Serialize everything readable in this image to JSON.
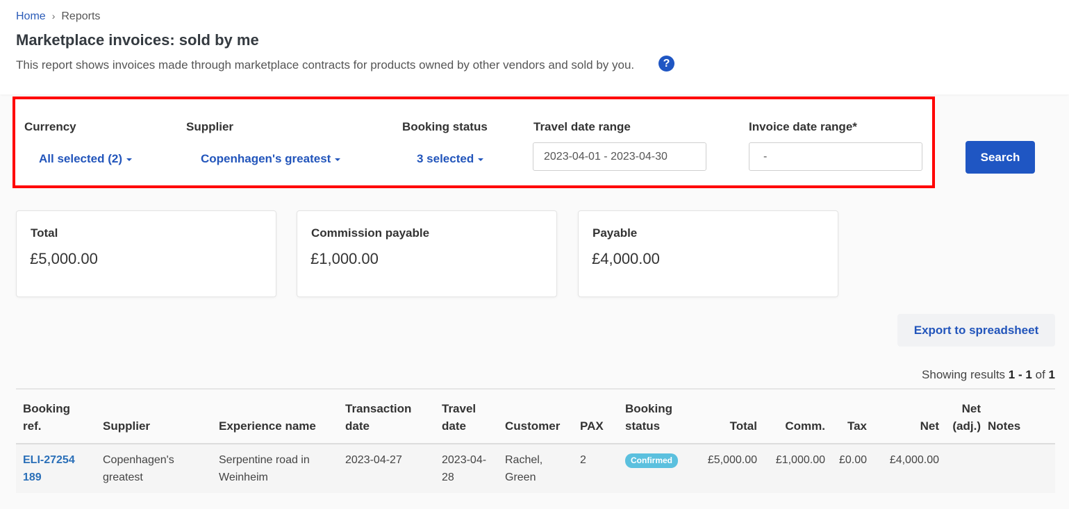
{
  "breadcrumb": {
    "home": "Home",
    "separator": "›",
    "current": "Reports"
  },
  "page": {
    "title": "Marketplace invoices: sold by me",
    "description": "This report shows invoices made through marketplace contracts for products owned by other vendors and sold by you.",
    "help_icon": "?"
  },
  "filters": {
    "currency": {
      "label": "Currency",
      "value": "All selected (2)"
    },
    "supplier": {
      "label": "Supplier",
      "value": "Copenhagen's greatest"
    },
    "booking_status": {
      "label": "Booking status",
      "value": "3 selected"
    },
    "travel_date_range": {
      "label": "Travel date range",
      "value": "2023-04-01 - 2023-04-30"
    },
    "invoice_date_range": {
      "label": "Invoice date range*",
      "value": "-"
    },
    "search_label": "Search"
  },
  "summary": [
    {
      "label": "Total",
      "value": "£5,000.00"
    },
    {
      "label": "Commission payable",
      "value": "£1,000.00"
    },
    {
      "label": "Payable",
      "value": "£4,000.00"
    }
  ],
  "export_label": "Export to spreadsheet",
  "results": {
    "prefix": "Showing results",
    "from": "1",
    "dash": "-",
    "to": "1",
    "of": "of",
    "total": "1"
  },
  "table": {
    "headers": {
      "booking_ref": [
        "Booking",
        "ref."
      ],
      "supplier": "Supplier",
      "experience": "Experience name",
      "transaction_date": [
        "Transaction",
        "date"
      ],
      "travel_date": [
        "Travel",
        "date"
      ],
      "customer": "Customer",
      "pax": "PAX",
      "booking_status": [
        "Booking",
        "status"
      ],
      "total": "Total",
      "comm": "Comm.",
      "tax": "Tax",
      "net": "Net",
      "net_adj": [
        "Net",
        "(adj.)"
      ],
      "notes": "Notes"
    },
    "rows": [
      {
        "booking_ref": "ELI-27254189",
        "supplier": "Copenhagen's greatest",
        "experience": "Serpentine road in Weinheim",
        "transaction_date": "2023-04-27",
        "travel_date": "2023-04-28",
        "customer": "Rachel, Green",
        "pax": "2",
        "booking_status": "Confirmed",
        "total": "£5,000.00",
        "comm": "£1,000.00",
        "tax": "£0.00",
        "net": "£4,000.00",
        "net_adj": "",
        "notes": ""
      }
    ]
  },
  "colors": {
    "accent": "#1f56c3",
    "link": "#2255bb",
    "badge": "#5bc0de",
    "highlight_border": "#ff0000"
  }
}
